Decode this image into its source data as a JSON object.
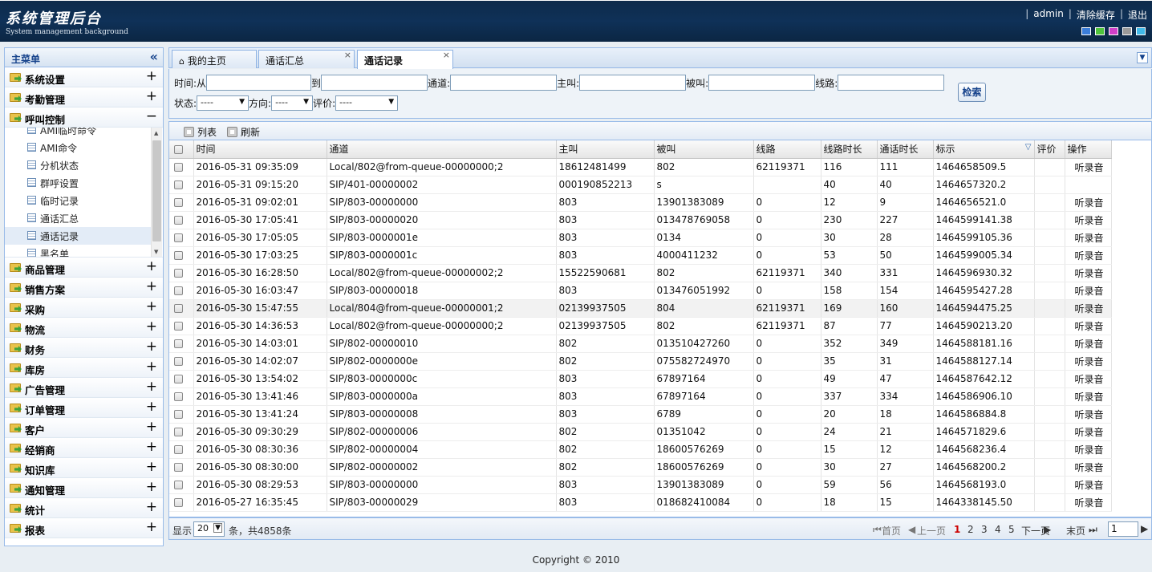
{
  "header": {
    "title": "系统管理后台",
    "subtitle": "System management background",
    "links": [
      "admin",
      "清除缓存",
      "退出"
    ],
    "skin_colors": [
      "#3b7dd8",
      "#4fc33c",
      "#d13fc9",
      "#9a9a9a",
      "#41b9e8"
    ]
  },
  "sidebar": {
    "title": "主菜单",
    "collapse_glyph": "«",
    "groups_top": [
      {
        "label": "系统设置",
        "toggle": "+"
      },
      {
        "label": "考勤管理",
        "toggle": "+"
      },
      {
        "label": "呼叫控制",
        "toggle": "−"
      }
    ],
    "sub_items": [
      "AMI临时命令",
      "AMI命令",
      "分机状态",
      "群呼设置",
      "临时记录",
      "通话汇总",
      "通话记录",
      "黑名单"
    ],
    "groups_bottom": [
      {
        "label": "商品管理",
        "toggle": "+"
      },
      {
        "label": "销售方案",
        "toggle": "+"
      },
      {
        "label": "采购",
        "toggle": "+"
      },
      {
        "label": "物流",
        "toggle": "+"
      },
      {
        "label": "财务",
        "toggle": "+"
      },
      {
        "label": "库房",
        "toggle": "+"
      },
      {
        "label": "广告管理",
        "toggle": "+"
      },
      {
        "label": "订单管理",
        "toggle": "+"
      },
      {
        "label": "客户",
        "toggle": "+"
      },
      {
        "label": "经销商",
        "toggle": "+"
      },
      {
        "label": "知识库",
        "toggle": "+"
      },
      {
        "label": "通知管理",
        "toggle": "+"
      },
      {
        "label": "统计",
        "toggle": "+"
      },
      {
        "label": "报表",
        "toggle": "+"
      }
    ]
  },
  "tabs": [
    {
      "label": "我的主页",
      "closable": false
    },
    {
      "label": "通话汇总",
      "closable": true
    },
    {
      "label": "通话记录",
      "closable": true
    }
  ],
  "search": {
    "time_from": "时间:从",
    "time_to": "到",
    "channel": "通道:",
    "caller": "主叫:",
    "callee": "被叫:",
    "line": "线路:",
    "status": "状态:",
    "status_value": "----",
    "direction": "方向:",
    "direction_value": "----",
    "rating": "评价:",
    "rating_value": "----",
    "button": "检索"
  },
  "toolbar": {
    "list": "列表",
    "refresh": "刷新"
  },
  "table": {
    "columns": [
      "时间",
      "通道",
      "主叫",
      "被叫",
      "线路",
      "线路时长",
      "通话时长",
      "标示",
      "评价",
      "操作"
    ],
    "rows": [
      [
        "2016-05-31 09:35:09",
        "Local/802@from-queue-00000000;2",
        "18612481499",
        "802",
        "62119371",
        "116",
        "111",
        "1464658509.5",
        "",
        "听录音"
      ],
      [
        "2016-05-31 09:15:20",
        "SIP/401-00000002",
        "000190852213",
        "s",
        "",
        "40",
        "40",
        "1464657320.2",
        "",
        ""
      ],
      [
        "2016-05-31 09:02:01",
        "SIP/803-00000000",
        "803",
        "13901383089",
        "0",
        "12",
        "9",
        "1464656521.0",
        "",
        "听录音"
      ],
      [
        "2016-05-30 17:05:41",
        "SIP/803-00000020",
        "803",
        "013478769058",
        "0",
        "230",
        "227",
        "1464599141.38",
        "",
        "听录音"
      ],
      [
        "2016-05-30 17:05:05",
        "SIP/803-0000001e",
        "803",
        "0134",
        "0",
        "30",
        "28",
        "1464599105.36",
        "",
        "听录音"
      ],
      [
        "2016-05-30 17:03:25",
        "SIP/803-0000001c",
        "803",
        "4000411232",
        "0",
        "53",
        "50",
        "1464599005.34",
        "",
        "听录音"
      ],
      [
        "2016-05-30 16:28:50",
        "Local/802@from-queue-00000002;2",
        "15522590681",
        "802",
        "62119371",
        "340",
        "331",
        "1464596930.32",
        "",
        "听录音"
      ],
      [
        "2016-05-30 16:03:47",
        "SIP/803-00000018",
        "803",
        "013476051992",
        "0",
        "158",
        "154",
        "1464595427.28",
        "",
        "听录音"
      ],
      [
        "2016-05-30 15:47:55",
        "Local/804@from-queue-00000001;2",
        "02139937505",
        "804",
        "62119371",
        "169",
        "160",
        "1464594475.25",
        "",
        "听录音"
      ],
      [
        "2016-05-30 14:36:53",
        "Local/802@from-queue-00000000;2",
        "02139937505",
        "802",
        "62119371",
        "87",
        "77",
        "1464590213.20",
        "",
        "听录音"
      ],
      [
        "2016-05-30 14:03:01",
        "SIP/802-00000010",
        "802",
        "013510427260",
        "0",
        "352",
        "349",
        "1464588181.16",
        "",
        "听录音"
      ],
      [
        "2016-05-30 14:02:07",
        "SIP/802-0000000e",
        "802",
        "075582724970",
        "0",
        "35",
        "31",
        "1464588127.14",
        "",
        "听录音"
      ],
      [
        "2016-05-30 13:54:02",
        "SIP/803-0000000c",
        "803",
        "67897164",
        "0",
        "49",
        "47",
        "1464587642.12",
        "",
        "听录音"
      ],
      [
        "2016-05-30 13:41:46",
        "SIP/803-0000000a",
        "803",
        "67897164",
        "0",
        "337",
        "334",
        "1464586906.10",
        "",
        "听录音"
      ],
      [
        "2016-05-30 13:41:24",
        "SIP/803-00000008",
        "803",
        "6789",
        "0",
        "20",
        "18",
        "1464586884.8",
        "",
        "听录音"
      ],
      [
        "2016-05-30 09:30:29",
        "SIP/802-00000006",
        "802",
        "01351042",
        "0",
        "24",
        "21",
        "1464571829.6",
        "",
        "听录音"
      ],
      [
        "2016-05-30 08:30:36",
        "SIP/802-00000004",
        "802",
        "18600576269",
        "0",
        "15",
        "12",
        "1464568236.4",
        "",
        "听录音"
      ],
      [
        "2016-05-30 08:30:00",
        "SIP/802-00000002",
        "802",
        "18600576269",
        "0",
        "30",
        "27",
        "1464568200.2",
        "",
        "听录音"
      ],
      [
        "2016-05-30 08:29:53",
        "SIP/803-00000000",
        "803",
        "13901383089",
        "0",
        "59",
        "56",
        "1464568193.0",
        "",
        "听录音"
      ],
      [
        "2016-05-27 16:35:45",
        "SIP/803-00000029",
        "803",
        "018682410084",
        "0",
        "18",
        "15",
        "1464338145.50",
        "",
        "听录音"
      ]
    ]
  },
  "pager": {
    "show": "显示",
    "page_size": "20",
    "total": "条，共4858条",
    "first": "首页",
    "prev": "上一页",
    "pages": [
      "1",
      "2",
      "3",
      "4",
      "5"
    ],
    "next": "下一页",
    "last": "末页",
    "goto_value": "1"
  },
  "footer": "Copyright © 2010"
}
